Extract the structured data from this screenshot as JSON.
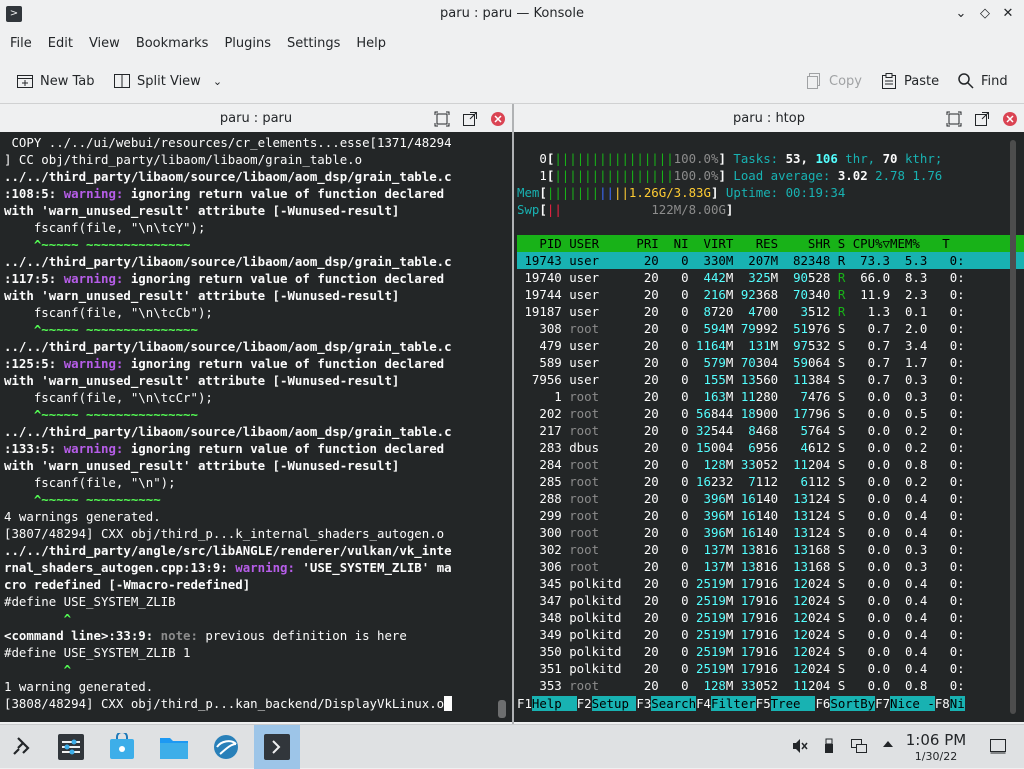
{
  "window": {
    "title": "paru : paru — Konsole",
    "app_icon": "konsole-icon",
    "controls": [
      "minimize-icon",
      "maximize-icon",
      "close-icon"
    ]
  },
  "menu": [
    "File",
    "Edit",
    "View",
    "Bookmarks",
    "Plugins",
    "Settings",
    "Help"
  ],
  "toolbar": {
    "new_tab": "New Tab",
    "split_view": "Split View",
    "copy": "Copy",
    "paste": "Paste",
    "find": "Find"
  },
  "left_pane": {
    "title": "paru : paru",
    "lines": [
      " COPY ../../ui/webui/resources/cr_elements...esse[1371/48294",
      "] CC obj/third_party/libaom/libaom/grain_table.o",
      "../../third_party/libaom/source/libaom/aom_dsp/grain_table.c",
      ":108:5: warning: ignoring return value of function declared",
      "with 'warn_unused_result' attribute [-Wunused-result]",
      "    fscanf(file, \"\\n\\tcY\");",
      "    ^~~~~~ ~~~~~~~~~~~~~~",
      "../../third_party/libaom/source/libaom/aom_dsp/grain_table.c",
      ":117:5: warning: ignoring return value of function declared",
      "with 'warn_unused_result' attribute [-Wunused-result]",
      "    fscanf(file, \"\\n\\tcCb\");",
      "    ^~~~~~ ~~~~~~~~~~~~~~~",
      "../../third_party/libaom/source/libaom/aom_dsp/grain_table.c",
      ":125:5: warning: ignoring return value of function declared",
      "with 'warn_unused_result' attribute [-Wunused-result]",
      "    fscanf(file, \"\\n\\tcCr\");",
      "    ^~~~~~ ~~~~~~~~~~~~~~~",
      "../../third_party/libaom/source/libaom/aom_dsp/grain_table.c",
      ":133:5: warning: ignoring return value of function declared",
      "with 'warn_unused_result' attribute [-Wunused-result]",
      "    fscanf(file, \"\\n\");",
      "    ^~~~~~ ~~~~~~~~~~",
      "4 warnings generated.",
      "[3807/48294] CXX obj/third_p...k_internal_shaders_autogen.o",
      "../../third_party/angle/src/libANGLE/renderer/vulkan/vk_inte",
      "rnal_shaders_autogen.cpp:13:9: warning: 'USE_SYSTEM_ZLIB' ma",
      "cro redefined [-Wmacro-redefined]",
      "#define USE_SYSTEM_ZLIB",
      "        ^",
      "<command line>:33:9: note: previous definition is here",
      "#define USE_SYSTEM_ZLIB 1",
      "        ^",
      "1 warning generated.",
      "[3808/48294] CXX obj/third_p...kan_backend/DisplayVkLinux.o"
    ]
  },
  "right_pane": {
    "title": "paru : htop",
    "cpu0": {
      "label": "0",
      "bar": "||||||||||||||||",
      "value": "100.0%"
    },
    "cpu1": {
      "label": "1",
      "bar": "||||||||||||||||",
      "value": "100.0%"
    },
    "mem": {
      "label": "Mem",
      "bar": "|||||||||||",
      "value": "1.26G/3.83G"
    },
    "swp": {
      "label": "Swp",
      "bar": "||",
      "value": "122M/8.00G"
    },
    "tasks": {
      "label": "Tasks:",
      "tasks": "53,",
      "thr_count": "106",
      "thr_label": "thr,",
      "kthr_count": "70",
      "kthr_label": "kthr;"
    },
    "load": {
      "label": "Load average:",
      "v1": "3.02",
      "v2": "2.78",
      "v3": "1.76"
    },
    "uptime": {
      "label": "Uptime:",
      "value": "00:19:34"
    },
    "columns": [
      "PID",
      "USER",
      "PRI",
      "NI",
      "VIRT",
      "RES",
      "SHR",
      "S",
      "CPU%",
      "MEM%",
      "T"
    ],
    "processes": [
      [
        "19743",
        "user",
        "20",
        "0",
        "330M",
        "207M",
        "82348",
        "R",
        "73.3",
        "5.3",
        "0:"
      ],
      [
        "19740",
        "user",
        "20",
        "0",
        "442M",
        "325M",
        "90528",
        "R",
        "66.0",
        "8.3",
        "0:"
      ],
      [
        "19744",
        "user",
        "20",
        "0",
        "216M",
        "92368",
        "70340",
        "R",
        "11.9",
        "2.3",
        "0:"
      ],
      [
        "19187",
        "user",
        "20",
        "0",
        "8720",
        "4700",
        "3512",
        "R",
        "1.3",
        "0.1",
        "0:"
      ],
      [
        "308",
        "root",
        "20",
        "0",
        "594M",
        "79992",
        "51976",
        "S",
        "0.7",
        "2.0",
        "0:"
      ],
      [
        "479",
        "user",
        "20",
        "0",
        "1164M",
        "131M",
        "97532",
        "S",
        "0.7",
        "3.4",
        "0:"
      ],
      [
        "589",
        "user",
        "20",
        "0",
        "579M",
        "70304",
        "59064",
        "S",
        "0.7",
        "1.7",
        "0:"
      ],
      [
        "7956",
        "user",
        "20",
        "0",
        "155M",
        "13560",
        "11384",
        "S",
        "0.7",
        "0.3",
        "0:"
      ],
      [
        "1",
        "root",
        "20",
        "0",
        "163M",
        "11280",
        "7476",
        "S",
        "0.0",
        "0.3",
        "0:"
      ],
      [
        "202",
        "root",
        "20",
        "0",
        "56844",
        "18900",
        "17796",
        "S",
        "0.0",
        "0.5",
        "0:"
      ],
      [
        "217",
        "root",
        "20",
        "0",
        "32544",
        "8468",
        "5764",
        "S",
        "0.0",
        "0.2",
        "0:"
      ],
      [
        "283",
        "dbus",
        "20",
        "0",
        "15004",
        "6956",
        "4612",
        "S",
        "0.0",
        "0.2",
        "0:"
      ],
      [
        "284",
        "root",
        "20",
        "0",
        "128M",
        "33052",
        "11204",
        "S",
        "0.0",
        "0.8",
        "0:"
      ],
      [
        "285",
        "root",
        "20",
        "0",
        "16232",
        "7112",
        "6112",
        "S",
        "0.0",
        "0.2",
        "0:"
      ],
      [
        "288",
        "root",
        "20",
        "0",
        "396M",
        "16140",
        "13124",
        "S",
        "0.0",
        "0.4",
        "0:"
      ],
      [
        "299",
        "root",
        "20",
        "0",
        "396M",
        "16140",
        "13124",
        "S",
        "0.0",
        "0.4",
        "0:"
      ],
      [
        "300",
        "root",
        "20",
        "0",
        "396M",
        "16140",
        "13124",
        "S",
        "0.0",
        "0.4",
        "0:"
      ],
      [
        "302",
        "root",
        "20",
        "0",
        "137M",
        "13816",
        "13168",
        "S",
        "0.0",
        "0.3",
        "0:"
      ],
      [
        "306",
        "root",
        "20",
        "0",
        "137M",
        "13816",
        "13168",
        "S",
        "0.0",
        "0.3",
        "0:"
      ],
      [
        "345",
        "polkitd",
        "20",
        "0",
        "2519M",
        "17916",
        "12024",
        "S",
        "0.0",
        "0.4",
        "0:"
      ],
      [
        "347",
        "polkitd",
        "20",
        "0",
        "2519M",
        "17916",
        "12024",
        "S",
        "0.0",
        "0.4",
        "0:"
      ],
      [
        "348",
        "polkitd",
        "20",
        "0",
        "2519M",
        "17916",
        "12024",
        "S",
        "0.0",
        "0.4",
        "0:"
      ],
      [
        "349",
        "polkitd",
        "20",
        "0",
        "2519M",
        "17916",
        "12024",
        "S",
        "0.0",
        "0.4",
        "0:"
      ],
      [
        "350",
        "polkitd",
        "20",
        "0",
        "2519M",
        "17916",
        "12024",
        "S",
        "0.0",
        "0.4",
        "0:"
      ],
      [
        "351",
        "polkitd",
        "20",
        "0",
        "2519M",
        "17916",
        "12024",
        "S",
        "0.0",
        "0.4",
        "0:"
      ],
      [
        "353",
        "root",
        "20",
        "0",
        "128M",
        "33052",
        "11204",
        "S",
        "0.0",
        "0.8",
        "0:"
      ]
    ],
    "fkeys": [
      {
        "key": "F1",
        "label": "Help  "
      },
      {
        "key": "F2",
        "label": "Setup "
      },
      {
        "key": "F3",
        "label": "Search"
      },
      {
        "key": "F4",
        "label": "Filter"
      },
      {
        "key": "F5",
        "label": "Tree  "
      },
      {
        "key": "F6",
        "label": "SortBy"
      },
      {
        "key": "F7",
        "label": "Nice -"
      },
      {
        "key": "F8",
        "label": "Ni"
      }
    ]
  },
  "taskbar": {
    "apps": [
      "application-launcher-icon",
      "system-settings-icon",
      "discover-store-icon",
      "file-manager-icon",
      "browser-icon",
      "konsole-icon"
    ],
    "tray": [
      "volume-muted-icon",
      "usb-icon",
      "network-icon",
      "tray-expand-icon"
    ],
    "time": "1:06 PM",
    "date": "1/30/22"
  },
  "colors": {
    "terminal_bg": "#232627",
    "htop_green": "#18b218",
    "htop_cyan": "#18b2b2",
    "warning_purple": "#b65de8"
  }
}
